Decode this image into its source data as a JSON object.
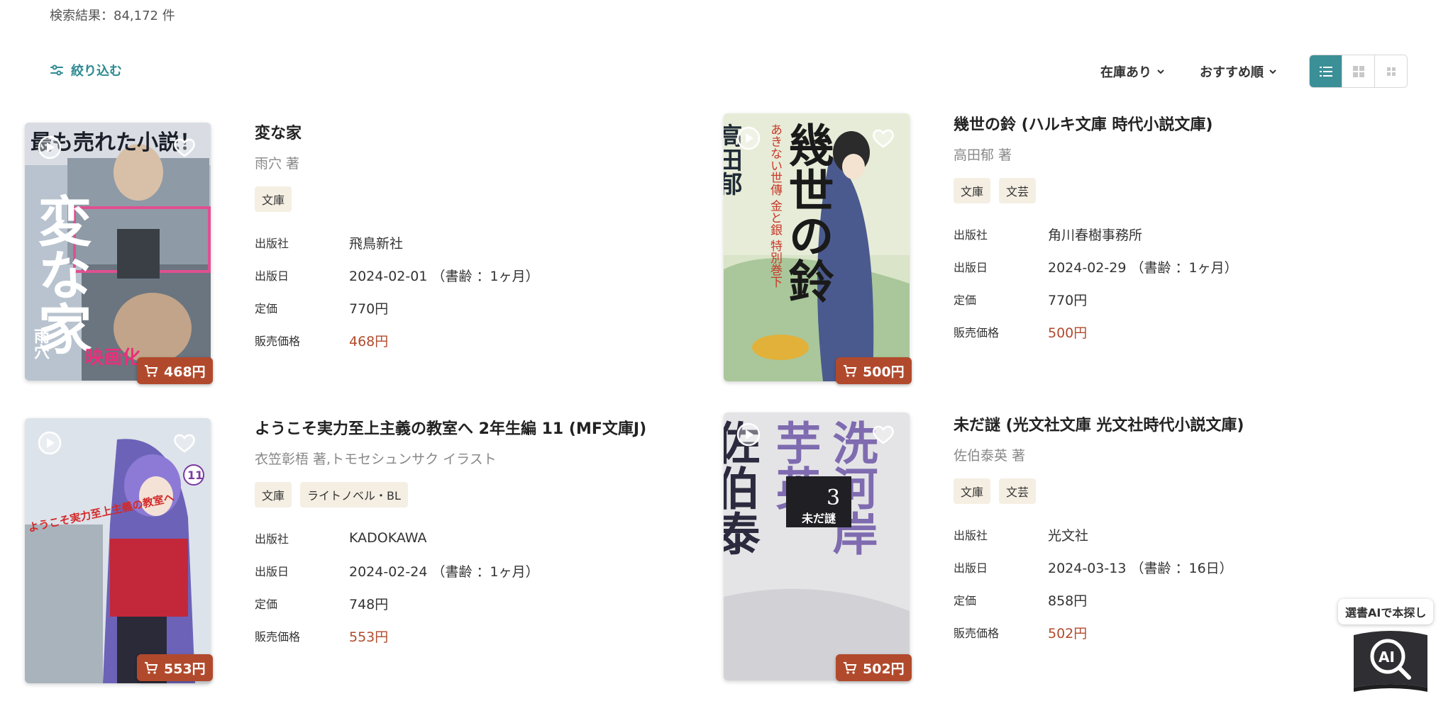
{
  "results": {
    "count_text": "検索結果：84,172 件"
  },
  "toolbar": {
    "filter_label": "絞り込む",
    "stock_label": "在庫あり",
    "sort_label": "おすすめ順"
  },
  "books": [
    {
      "title": "変な家",
      "author": "雨穴 著",
      "tags": [
        "文庫"
      ],
      "publisher_label": "出版社",
      "publisher": "飛鳥新社",
      "date_label": "出版日",
      "date": "2024-02-01 （書齢 ：1ヶ月）",
      "price_label": "定価",
      "price": "770円",
      "sale_label": "販売価格",
      "sale_price": "468円",
      "cart_price": "468円"
    },
    {
      "title": "幾世の鈴 (ハルキ文庫 時代小説文庫)",
      "author": "高田郁 著",
      "tags": [
        "文庫",
        "文芸"
      ],
      "publisher_label": "出版社",
      "publisher": "角川春樹事務所",
      "date_label": "出版日",
      "date": "2024-02-29 （書齢 ：1ヶ月）",
      "price_label": "定価",
      "price": "770円",
      "sale_label": "販売価格",
      "sale_price": "500円",
      "cart_price": "500円"
    },
    {
      "title": "ようこそ実力至上主義の教室へ 2年生編 11 (MF文庫J)",
      "author": "衣笠彰梧 著,トモセシュンサク イラスト",
      "tags": [
        "文庫",
        "ライトノベル・BL"
      ],
      "publisher_label": "出版社",
      "publisher": "KADOKAWA",
      "date_label": "出版日",
      "date": "2024-02-24 （書齢 ：1ヶ月）",
      "price_label": "定価",
      "price": "748円",
      "sale_label": "販売価格",
      "sale_price": "553円",
      "cart_price": "553円"
    },
    {
      "title": "未だ謎 (光文社文庫 光文社時代小説文庫)",
      "author": "佐伯泰英 著",
      "tags": [
        "文庫",
        "文芸"
      ],
      "publisher_label": "出版社",
      "publisher": "光文社",
      "date_label": "出版日",
      "date": "2024-03-13 （書齢 ：16日）",
      "price_label": "定価",
      "price": "858円",
      "sale_label": "販売価格",
      "sale_price": "502円",
      "cart_price": "502円"
    }
  ],
  "covers": {
    "book0": {
      "top": "最も売れた小説！",
      "title": "変な家",
      "author": "雨穴",
      "banner": "映画化"
    },
    "book1": {
      "title": "幾世の鈴",
      "author": "高田郁",
      "sub": "あきない世傳 金と銀 特別巻下"
    },
    "book2": {
      "title": "ようこそ実力至上主義の教室へ",
      "vol": "11"
    },
    "book3": {
      "right": "洗河岸",
      "mid": "芋英",
      "left": "佐伯泰",
      "num": "3",
      "title": "未だ謎"
    }
  },
  "ai": {
    "label": "選書AIで本探し",
    "icon": "AI"
  },
  "colors": {
    "accent": "#3b8f97",
    "sale": "#b14a2c",
    "tag_bg": "#f5efe3"
  }
}
